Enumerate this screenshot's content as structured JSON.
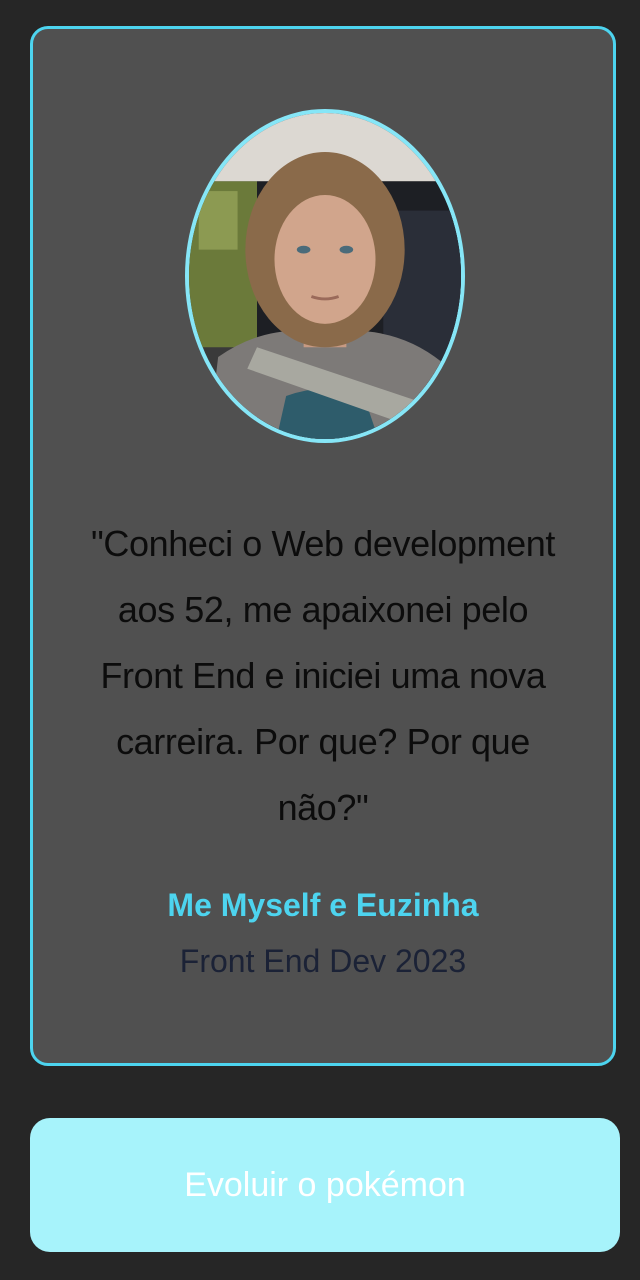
{
  "testimonial": {
    "quote": "\"Conheci o Web development aos 52, me apaixonei pelo Front End e iniciei uma nova carreira. Por que? Por que não?\"",
    "author_name": "Me Myself e Euzinha",
    "author_role": "Front End Dev 2023"
  },
  "action": {
    "evolve_label": "Evoluir o pokémon"
  },
  "colors": {
    "page_background": "#262626",
    "card_background": "#505050",
    "accent": "#4dd4ef",
    "button_background": "#a7f3fb",
    "button_text": "#ffffff",
    "quote_text": "#0c0c0c",
    "role_text": "#1b2236"
  }
}
